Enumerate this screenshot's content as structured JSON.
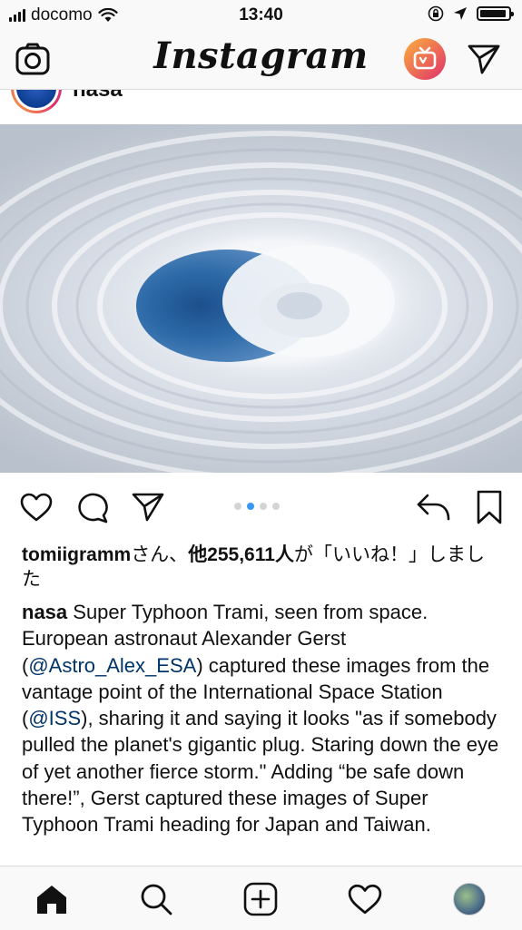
{
  "status_bar": {
    "carrier": "docomo",
    "time": "13:40"
  },
  "header": {
    "logo": "Instagram",
    "icons": [
      "camera-icon",
      "igtv-icon",
      "direct-message-icon"
    ],
    "igtv_gradient": [
      "#f9b13c",
      "#e1306c"
    ]
  },
  "post": {
    "username": "nasa",
    "carousel": {
      "count": 4,
      "active_index": 1
    },
    "likes": {
      "liker": "tomiigramm",
      "text_1": "さん、",
      "others": "他255,611人",
      "text_2": "が「いいね！」しました"
    },
    "caption": {
      "author": "nasa",
      "part1": " Super Typhoon Trami, seen from space. European astronaut Alexander Gerst (",
      "mention1": "@Astro_Alex_ESA",
      "part2": ") captured these images from the vantage point of the International Space Station (",
      "mention2": "@ISS",
      "part3": "), sharing it and saying it looks \"as if somebody pulled the planet's gigantic plug. Staring down the eye of yet another fierce storm.\" Adding “be safe down there!”, Gerst captured these images of Super Typhoon Trami heading for Japan and Taiwan."
    }
  },
  "tab_bar": {
    "items": [
      "home-icon",
      "search-icon",
      "new-post-icon",
      "activity-icon",
      "profile-avatar"
    ]
  },
  "colors": {
    "mention": "#003569",
    "carousel_active": "#3897f0"
  }
}
